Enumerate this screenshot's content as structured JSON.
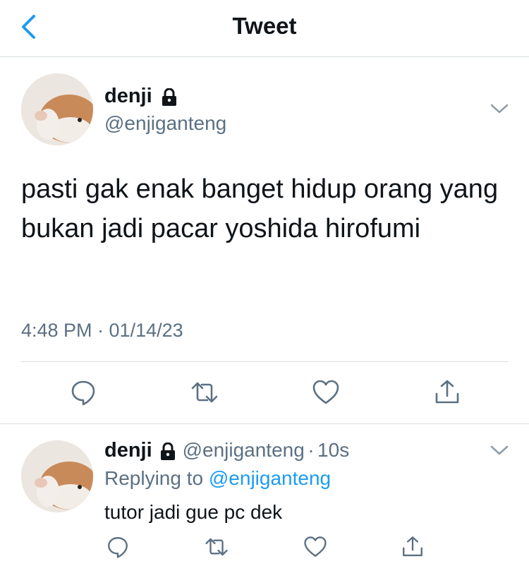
{
  "header": {
    "title": "Tweet"
  },
  "tweet": {
    "name": "denji",
    "handle": "@enjiganteng",
    "text": "pasti gak enak banget hidup orang yang bukan jadi pacar yoshida hirofumi",
    "timestamp": "4:48 PM · 01/14/23"
  },
  "reply": {
    "name": "denji",
    "handle": "@enjiganteng",
    "dot": "·",
    "age": "10s",
    "replying_prefix": "Replying to ",
    "replying_to": "@enjiganteng",
    "text": "tutor jadi gue pc dek"
  },
  "colors": {
    "accent": "#1d9bf0",
    "muted": "#5b7083",
    "divider": "#d9dde0"
  },
  "icons": [
    "back-chevron-icon",
    "lock-icon",
    "chevron-down-icon",
    "reply-icon",
    "retweet-icon",
    "like-icon",
    "share-icon"
  ]
}
